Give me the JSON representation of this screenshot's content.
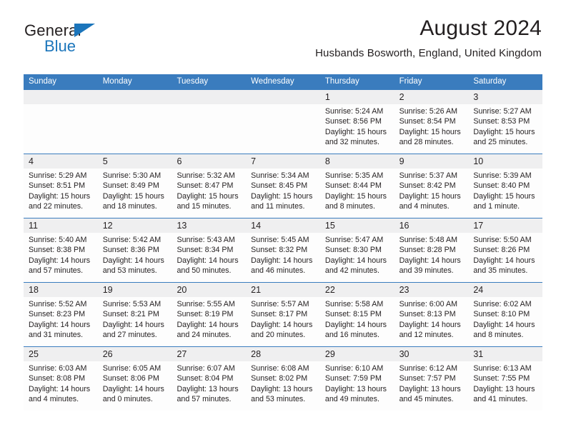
{
  "brand": {
    "name_part1": "General",
    "name_part2": "Blue",
    "accent_color": "#1b75bb"
  },
  "header": {
    "title": "August 2024",
    "subtitle": "Husbands Bosworth, England, United Kingdom"
  },
  "theme": {
    "header_bg": "#3a7cbe",
    "day_band_bg": "#efeff0",
    "text_color": "#231f20"
  },
  "weekday_headers": [
    "Sunday",
    "Monday",
    "Tuesday",
    "Wednesday",
    "Thursday",
    "Friday",
    "Saturday"
  ],
  "weeks": [
    [
      {
        "day": "",
        "empty": true,
        "lines": [
          "",
          "",
          "",
          ""
        ]
      },
      {
        "day": "",
        "empty": true,
        "lines": [
          "",
          "",
          "",
          ""
        ]
      },
      {
        "day": "",
        "empty": true,
        "lines": [
          "",
          "",
          "",
          ""
        ]
      },
      {
        "day": "",
        "empty": true,
        "lines": [
          "",
          "",
          "",
          ""
        ]
      },
      {
        "day": "1",
        "empty": false,
        "lines": [
          "Sunrise: 5:24 AM",
          "Sunset: 8:56 PM",
          "Daylight: 15 hours",
          "and 32 minutes."
        ]
      },
      {
        "day": "2",
        "empty": false,
        "lines": [
          "Sunrise: 5:26 AM",
          "Sunset: 8:54 PM",
          "Daylight: 15 hours",
          "and 28 minutes."
        ]
      },
      {
        "day": "3",
        "empty": false,
        "lines": [
          "Sunrise: 5:27 AM",
          "Sunset: 8:53 PM",
          "Daylight: 15 hours",
          "and 25 minutes."
        ]
      }
    ],
    [
      {
        "day": "4",
        "empty": false,
        "lines": [
          "Sunrise: 5:29 AM",
          "Sunset: 8:51 PM",
          "Daylight: 15 hours",
          "and 22 minutes."
        ]
      },
      {
        "day": "5",
        "empty": false,
        "lines": [
          "Sunrise: 5:30 AM",
          "Sunset: 8:49 PM",
          "Daylight: 15 hours",
          "and 18 minutes."
        ]
      },
      {
        "day": "6",
        "empty": false,
        "lines": [
          "Sunrise: 5:32 AM",
          "Sunset: 8:47 PM",
          "Daylight: 15 hours",
          "and 15 minutes."
        ]
      },
      {
        "day": "7",
        "empty": false,
        "lines": [
          "Sunrise: 5:34 AM",
          "Sunset: 8:45 PM",
          "Daylight: 15 hours",
          "and 11 minutes."
        ]
      },
      {
        "day": "8",
        "empty": false,
        "lines": [
          "Sunrise: 5:35 AM",
          "Sunset: 8:44 PM",
          "Daylight: 15 hours",
          "and 8 minutes."
        ]
      },
      {
        "day": "9",
        "empty": false,
        "lines": [
          "Sunrise: 5:37 AM",
          "Sunset: 8:42 PM",
          "Daylight: 15 hours",
          "and 4 minutes."
        ]
      },
      {
        "day": "10",
        "empty": false,
        "lines": [
          "Sunrise: 5:39 AM",
          "Sunset: 8:40 PM",
          "Daylight: 15 hours",
          "and 1 minute."
        ]
      }
    ],
    [
      {
        "day": "11",
        "empty": false,
        "lines": [
          "Sunrise: 5:40 AM",
          "Sunset: 8:38 PM",
          "Daylight: 14 hours",
          "and 57 minutes."
        ]
      },
      {
        "day": "12",
        "empty": false,
        "lines": [
          "Sunrise: 5:42 AM",
          "Sunset: 8:36 PM",
          "Daylight: 14 hours",
          "and 53 minutes."
        ]
      },
      {
        "day": "13",
        "empty": false,
        "lines": [
          "Sunrise: 5:43 AM",
          "Sunset: 8:34 PM",
          "Daylight: 14 hours",
          "and 50 minutes."
        ]
      },
      {
        "day": "14",
        "empty": false,
        "lines": [
          "Sunrise: 5:45 AM",
          "Sunset: 8:32 PM",
          "Daylight: 14 hours",
          "and 46 minutes."
        ]
      },
      {
        "day": "15",
        "empty": false,
        "lines": [
          "Sunrise: 5:47 AM",
          "Sunset: 8:30 PM",
          "Daylight: 14 hours",
          "and 42 minutes."
        ]
      },
      {
        "day": "16",
        "empty": false,
        "lines": [
          "Sunrise: 5:48 AM",
          "Sunset: 8:28 PM",
          "Daylight: 14 hours",
          "and 39 minutes."
        ]
      },
      {
        "day": "17",
        "empty": false,
        "lines": [
          "Sunrise: 5:50 AM",
          "Sunset: 8:26 PM",
          "Daylight: 14 hours",
          "and 35 minutes."
        ]
      }
    ],
    [
      {
        "day": "18",
        "empty": false,
        "lines": [
          "Sunrise: 5:52 AM",
          "Sunset: 8:23 PM",
          "Daylight: 14 hours",
          "and 31 minutes."
        ]
      },
      {
        "day": "19",
        "empty": false,
        "lines": [
          "Sunrise: 5:53 AM",
          "Sunset: 8:21 PM",
          "Daylight: 14 hours",
          "and 27 minutes."
        ]
      },
      {
        "day": "20",
        "empty": false,
        "lines": [
          "Sunrise: 5:55 AM",
          "Sunset: 8:19 PM",
          "Daylight: 14 hours",
          "and 24 minutes."
        ]
      },
      {
        "day": "21",
        "empty": false,
        "lines": [
          "Sunrise: 5:57 AM",
          "Sunset: 8:17 PM",
          "Daylight: 14 hours",
          "and 20 minutes."
        ]
      },
      {
        "day": "22",
        "empty": false,
        "lines": [
          "Sunrise: 5:58 AM",
          "Sunset: 8:15 PM",
          "Daylight: 14 hours",
          "and 16 minutes."
        ]
      },
      {
        "day": "23",
        "empty": false,
        "lines": [
          "Sunrise: 6:00 AM",
          "Sunset: 8:13 PM",
          "Daylight: 14 hours",
          "and 12 minutes."
        ]
      },
      {
        "day": "24",
        "empty": false,
        "lines": [
          "Sunrise: 6:02 AM",
          "Sunset: 8:10 PM",
          "Daylight: 14 hours",
          "and 8 minutes."
        ]
      }
    ],
    [
      {
        "day": "25",
        "empty": false,
        "lines": [
          "Sunrise: 6:03 AM",
          "Sunset: 8:08 PM",
          "Daylight: 14 hours",
          "and 4 minutes."
        ]
      },
      {
        "day": "26",
        "empty": false,
        "lines": [
          "Sunrise: 6:05 AM",
          "Sunset: 8:06 PM",
          "Daylight: 14 hours",
          "and 0 minutes."
        ]
      },
      {
        "day": "27",
        "empty": false,
        "lines": [
          "Sunrise: 6:07 AM",
          "Sunset: 8:04 PM",
          "Daylight: 13 hours",
          "and 57 minutes."
        ]
      },
      {
        "day": "28",
        "empty": false,
        "lines": [
          "Sunrise: 6:08 AM",
          "Sunset: 8:02 PM",
          "Daylight: 13 hours",
          "and 53 minutes."
        ]
      },
      {
        "day": "29",
        "empty": false,
        "lines": [
          "Sunrise: 6:10 AM",
          "Sunset: 7:59 PM",
          "Daylight: 13 hours",
          "and 49 minutes."
        ]
      },
      {
        "day": "30",
        "empty": false,
        "lines": [
          "Sunrise: 6:12 AM",
          "Sunset: 7:57 PM",
          "Daylight: 13 hours",
          "and 45 minutes."
        ]
      },
      {
        "day": "31",
        "empty": false,
        "lines": [
          "Sunrise: 6:13 AM",
          "Sunset: 7:55 PM",
          "Daylight: 13 hours",
          "and 41 minutes."
        ]
      }
    ]
  ]
}
